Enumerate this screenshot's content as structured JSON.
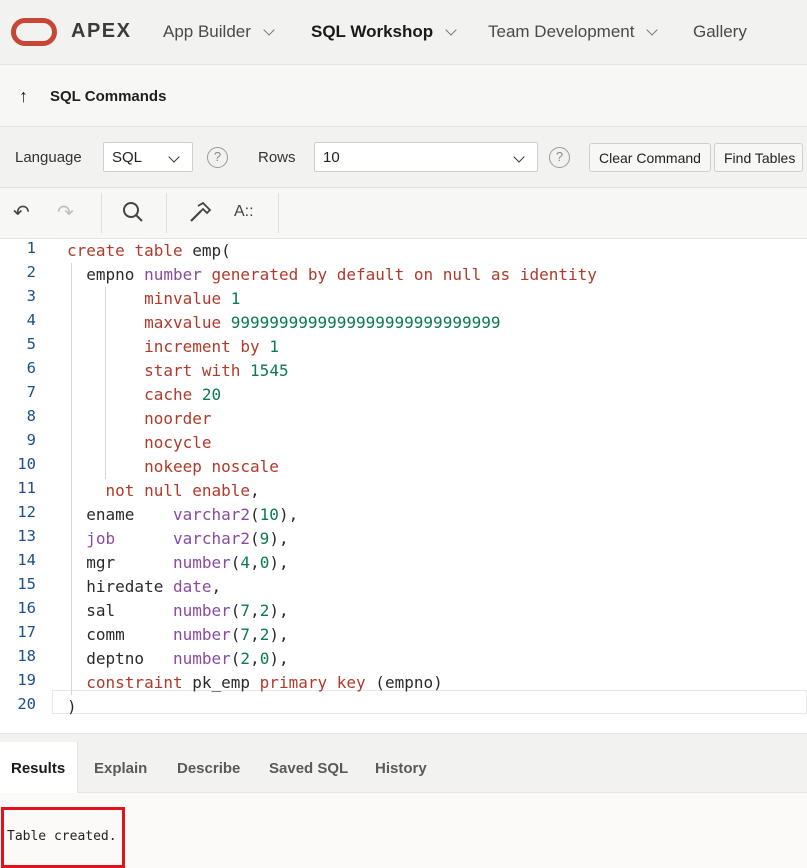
{
  "app": {
    "brand": "APEX"
  },
  "nav": {
    "items": [
      {
        "label": "App Builder",
        "has_menu": true
      },
      {
        "label": "SQL Workshop",
        "has_menu": true,
        "active": true
      },
      {
        "label": "Team Development",
        "has_menu": true
      },
      {
        "label": "Gallery",
        "has_menu": false
      }
    ]
  },
  "breadcrumb": {
    "title": "SQL Commands"
  },
  "command_bar": {
    "language_label": "Language",
    "language_value": "SQL",
    "rows_label": "Rows",
    "rows_value": "10",
    "clear_button": "Clear Command",
    "find_button": "Find Tables",
    "help_glyph": "?"
  },
  "editor_tools": {
    "undo_icon": "undo-icon",
    "redo_icon": "redo-icon",
    "search_icon": "search-icon",
    "build_icon": "hammer-icon",
    "format_icon": "A::"
  },
  "editor": {
    "line_numbers": [
      "1",
      "2",
      "3",
      "4",
      "5",
      "6",
      "7",
      "8",
      "9",
      "10",
      "11",
      "12",
      "13",
      "14",
      "15",
      "16",
      "17",
      "18",
      "19",
      "20"
    ],
    "lines": [
      "create table emp(",
      "  empno number generated by default on null as identity",
      "        minvalue 1",
      "        maxvalue 9999999999999999999999999999",
      "        increment by 1",
      "        start with 1545",
      "        cache 20",
      "        noorder",
      "        nocycle",
      "        nokeep noscale",
      "    not null enable,",
      "  ename    varchar2(10),",
      "  job      varchar2(9),",
      "  mgr      number(4,0),",
      "  hiredate date,",
      "  sal      number(7,2),",
      "  comm     number(7,2),",
      "  deptno   number(2,0),",
      "  constraint pk_emp primary key (empno)",
      ")"
    ]
  },
  "results": {
    "tabs": [
      "Results",
      "Explain",
      "Describe",
      "Saved SQL",
      "History"
    ],
    "active_tab": "Results",
    "message": "Table created."
  },
  "colors": {
    "brand_red": "#c74634",
    "highlight_box": "#e0121b"
  }
}
